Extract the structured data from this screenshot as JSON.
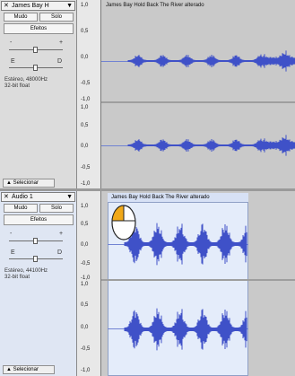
{
  "track1": {
    "name": "James Bay H",
    "mute_label": "Mudo",
    "solo_label": "Solo",
    "effects_label": "Efeitos",
    "slider_minus": "-",
    "slider_plus": "+",
    "pan_left": "E",
    "pan_right": "D",
    "info_line1": "Estéreo, 48000Hz",
    "info_line2": "32-bit float",
    "select_label": "Selecionar",
    "clip_name": "James Bay Hold Back The River alterado",
    "ruler_labels": [
      "1,0",
      "0,5",
      "0,0",
      "-0,5",
      "-1,0",
      "1,0",
      "0,5",
      "0,0",
      "-0,5",
      "-1,0"
    ]
  },
  "track2": {
    "name": "Áudio 1",
    "mute_label": "Mudo",
    "solo_label": "Solo",
    "effects_label": "Efeitos",
    "slider_minus": "-",
    "slider_plus": "+",
    "pan_left": "E",
    "pan_right": "D",
    "info_line1": "Estéreo, 44100Hz",
    "info_line2": "32-bit float",
    "select_label": "Selecionar",
    "clip_name": "James Bay Hold Back The River alterado",
    "ruler_labels": [
      "1,0",
      "0,5",
      "0,0",
      "-0,5",
      "-1,0",
      "1,0",
      "0,5",
      "0,0",
      "-0,5",
      "-1,0"
    ]
  },
  "icons": {
    "close": "close-icon",
    "dropdown": "dropdown-arrow-icon",
    "collapse": "collapse-arrow-icon",
    "cursor": "mouse-left-click-icon"
  },
  "colors": {
    "waveform": "#3f51c8",
    "clip_bg": "#e4ecfa",
    "click_highlight": "#f0a818"
  }
}
